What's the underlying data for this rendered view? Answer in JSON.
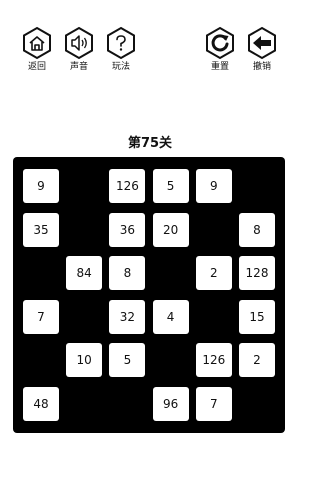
{
  "toolbar": {
    "back_label": "返回",
    "sound_label": "声音",
    "rules_label": "玩法",
    "reset_label": "重置",
    "undo_label": "撤销"
  },
  "level": {
    "title": "第75关"
  },
  "board": {
    "rows": 6,
    "cols": 6,
    "cells": [
      {
        "row": 0,
        "col": 0,
        "value": "9"
      },
      {
        "row": 0,
        "col": 2,
        "value": "126"
      },
      {
        "row": 0,
        "col": 3,
        "value": "5"
      },
      {
        "row": 0,
        "col": 4,
        "value": "9"
      },
      {
        "row": 1,
        "col": 0,
        "value": "35"
      },
      {
        "row": 1,
        "col": 2,
        "value": "36"
      },
      {
        "row": 1,
        "col": 3,
        "value": "20"
      },
      {
        "row": 1,
        "col": 5,
        "value": "8"
      },
      {
        "row": 2,
        "col": 1,
        "value": "84"
      },
      {
        "row": 2,
        "col": 2,
        "value": "8"
      },
      {
        "row": 2,
        "col": 4,
        "value": "2"
      },
      {
        "row": 2,
        "col": 5,
        "value": "128"
      },
      {
        "row": 3,
        "col": 0,
        "value": "7"
      },
      {
        "row": 3,
        "col": 2,
        "value": "32"
      },
      {
        "row": 3,
        "col": 3,
        "value": "4"
      },
      {
        "row": 3,
        "col": 5,
        "value": "15"
      },
      {
        "row": 4,
        "col": 1,
        "value": "10"
      },
      {
        "row": 4,
        "col": 2,
        "value": "5"
      },
      {
        "row": 4,
        "col": 4,
        "value": "126"
      },
      {
        "row": 4,
        "col": 5,
        "value": "2"
      },
      {
        "row": 5,
        "col": 0,
        "value": "48"
      },
      {
        "row": 5,
        "col": 3,
        "value": "96"
      },
      {
        "row": 5,
        "col": 4,
        "value": "7"
      }
    ]
  },
  "colors": {
    "board": "#000000",
    "tile": "#ffffff",
    "text": "#111111"
  }
}
